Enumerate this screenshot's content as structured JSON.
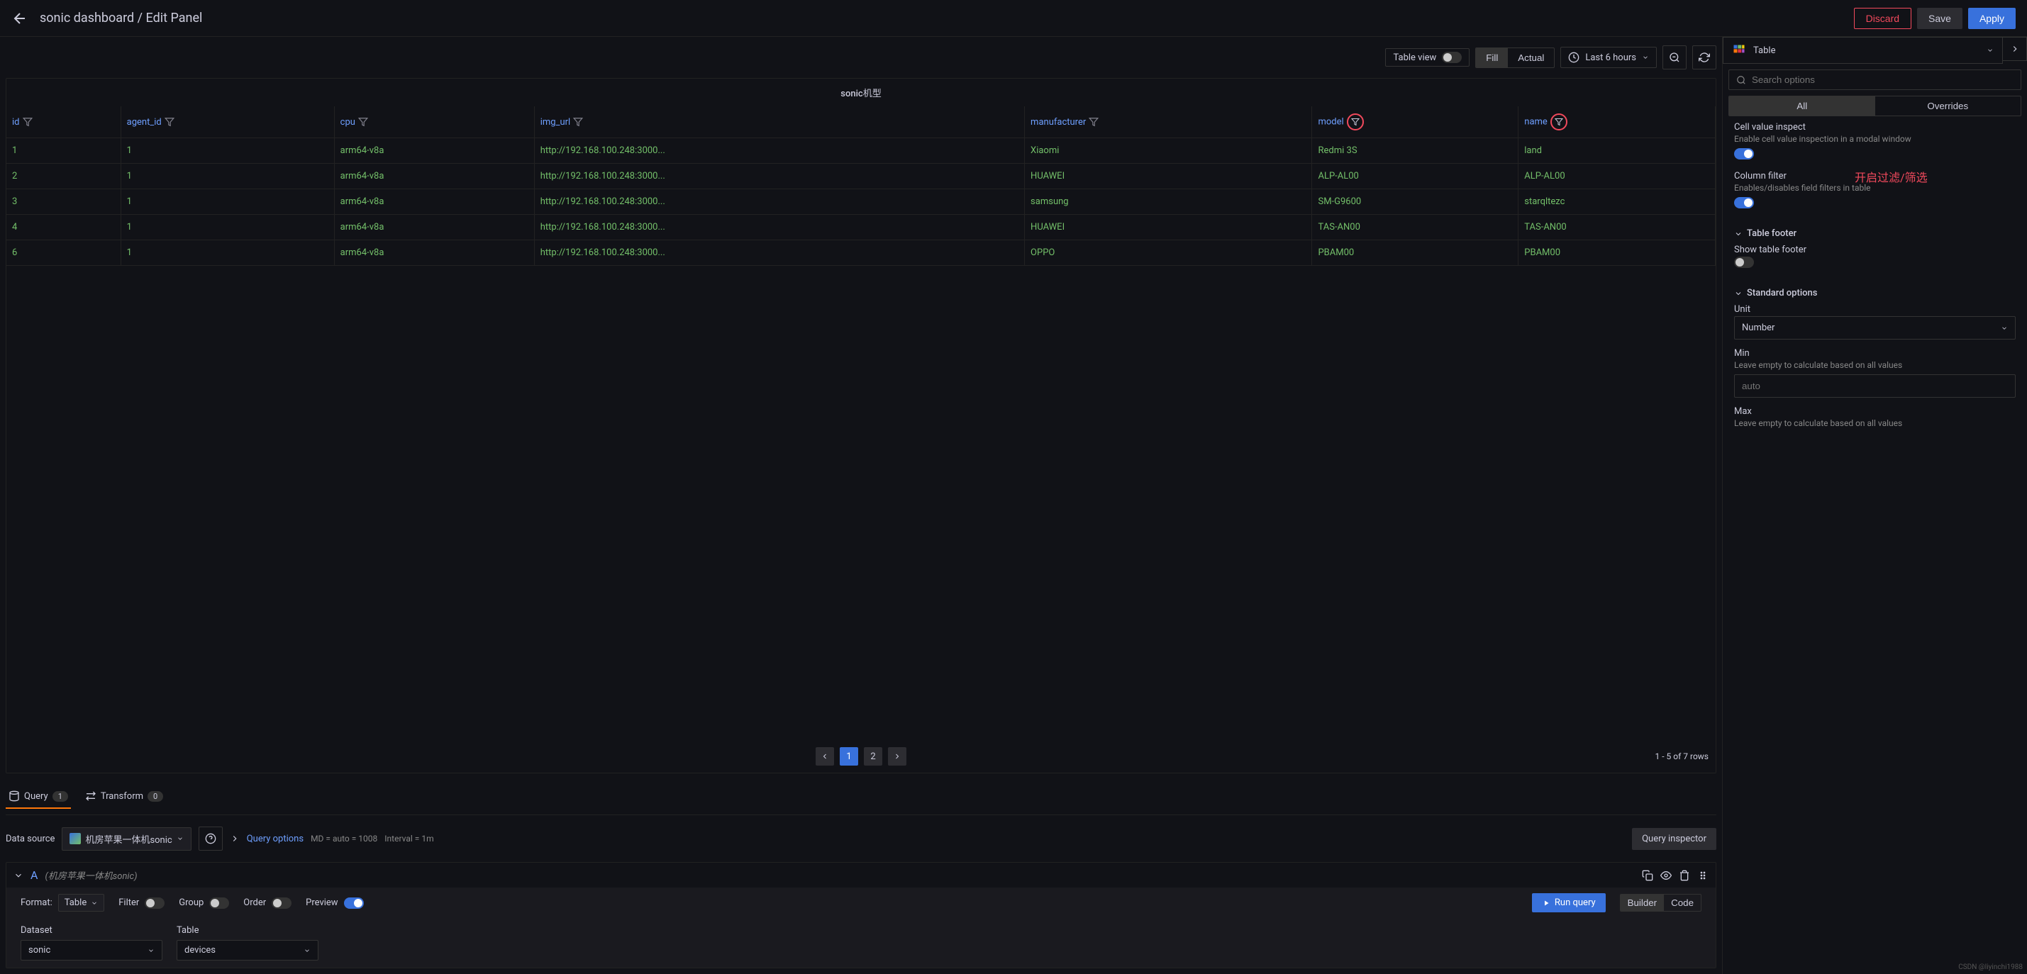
{
  "header": {
    "title": "sonic dashboard / Edit Panel",
    "discard": "Discard",
    "save": "Save",
    "apply": "Apply"
  },
  "toolbar": {
    "table_view": "Table view",
    "fill": "Fill",
    "actual": "Actual",
    "time_range": "Last 6 hours"
  },
  "panel": {
    "title": "sonic机型",
    "columns": [
      "id",
      "agent_id",
      "cpu",
      "img_url",
      "manufacturer",
      "model",
      "name"
    ],
    "rows": [
      {
        "id": "1",
        "agent_id": "1",
        "cpu": "arm64-v8a",
        "img_url": "http://192.168.100.248:3000...",
        "manufacturer": "Xiaomi",
        "model": "Redmi 3S",
        "name": "land"
      },
      {
        "id": "2",
        "agent_id": "1",
        "cpu": "arm64-v8a",
        "img_url": "http://192.168.100.248:3000...",
        "manufacturer": "HUAWEI",
        "model": "ALP-AL00",
        "name": "ALP-AL00"
      },
      {
        "id": "3",
        "agent_id": "1",
        "cpu": "arm64-v8a",
        "img_url": "http://192.168.100.248:3000...",
        "manufacturer": "samsung",
        "model": "SM-G9600",
        "name": "starqltezc"
      },
      {
        "id": "4",
        "agent_id": "1",
        "cpu": "arm64-v8a",
        "img_url": "http://192.168.100.248:3000...",
        "manufacturer": "HUAWEI",
        "model": "TAS-AN00",
        "name": "TAS-AN00"
      },
      {
        "id": "6",
        "agent_id": "1",
        "cpu": "arm64-v8a",
        "img_url": "http://192.168.100.248:3000...",
        "manufacturer": "OPPO",
        "model": "PBAM00",
        "name": "PBAM00"
      }
    ],
    "pagination": {
      "pages": [
        "1",
        "2"
      ],
      "active": "1",
      "info": "1 - 5 of 7 rows"
    }
  },
  "tabs": {
    "query": "Query",
    "query_count": "1",
    "transform": "Transform",
    "transform_count": "0"
  },
  "query": {
    "data_source_label": "Data source",
    "data_source": "机房苹果一体机sonic",
    "options": "Query options",
    "meta_md": "MD = auto = 1008",
    "meta_interval": "Interval = 1m",
    "inspector": "Query inspector",
    "letter": "A",
    "ds_name": "(机房苹果一体机sonic)",
    "format_label": "Format:",
    "format_value": "Table",
    "filter": "Filter",
    "group": "Group",
    "order": "Order",
    "preview": "Preview",
    "run": "Run query",
    "builder": "Builder",
    "code": "Code",
    "dataset_label": "Dataset",
    "dataset_value": "sonic",
    "table_label": "Table",
    "table_value": "devices"
  },
  "viz": {
    "type": "Table"
  },
  "options": {
    "search_placeholder": "Search options",
    "all": "All",
    "overrides": "Overrides",
    "cell_inspect_title": "Cell value inspect",
    "cell_inspect_desc": "Enable cell value inspection in a modal window",
    "column_filter_title": "Column filter",
    "column_filter_desc": "Enables/disables field filters in table",
    "annotation": "开启过滤/筛选",
    "table_footer": "Table footer",
    "show_footer": "Show table footer",
    "std_options": "Standard options",
    "unit": "Unit",
    "unit_value": "Number",
    "min": "Min",
    "min_desc": "Leave empty to calculate based on all values",
    "min_placeholder": "auto",
    "max": "Max",
    "max_desc": "Leave empty to calculate based on all values"
  },
  "watermark": "CSDN @liyinchi1988"
}
